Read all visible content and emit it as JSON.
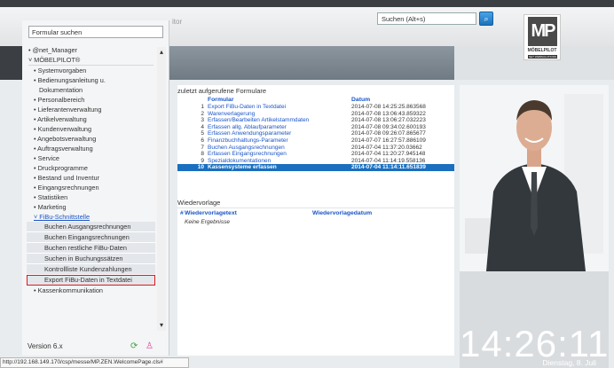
{
  "header": {
    "title_fragment": "itor",
    "search_placeholder": "Suchen (Alt+s)",
    "search_button_icon": "search-icon",
    "logo": {
      "mark": "MP",
      "name": "MÖBELPILOT",
      "tagline": "NET WEBSOLUTIONS"
    }
  },
  "sidebar": {
    "search_value": "Formular suchen",
    "collapse_arrow": "▴",
    "items": [
      {
        "label": "• @net_Manager",
        "level": 0
      },
      {
        "label": "˅ MÖBELPILOT®",
        "level": 0
      },
      {
        "label": "• Systemvorgaben",
        "level": 1
      },
      {
        "label": "• Bedienungsanleitung u.",
        "level": 1
      },
      {
        "label": "Dokumentation",
        "level": 1,
        "cont": true
      },
      {
        "label": "• Personalbereich",
        "level": 1
      },
      {
        "label": "• Lieferantenverwaltung",
        "level": 1
      },
      {
        "label": "• Artikelverwaltung",
        "level": 1
      },
      {
        "label": "• Kundenverwaltung",
        "level": 1
      },
      {
        "label": "• Angebotsverwaltung",
        "level": 1
      },
      {
        "label": "• Auftragsverwaltung",
        "level": 1
      },
      {
        "label": "• Service",
        "level": 1
      },
      {
        "label": "• Druckprogramme",
        "level": 1
      },
      {
        "label": "• Bestand und Inventur",
        "level": 1
      },
      {
        "label": "• Eingangsrechnungen",
        "level": 1
      },
      {
        "label": "• Statistiken",
        "level": 1
      },
      {
        "label": "• Marketing",
        "level": 1
      },
      {
        "label": "˅ FiBu-Schnittstelle",
        "level": 1,
        "active": true
      },
      {
        "label": "Buchen Ausgangsrechnungen",
        "level": 2
      },
      {
        "label": "Buchen Eingangsrechnungen",
        "level": 2
      },
      {
        "label": "Buchen restliche FiBu-Daten",
        "level": 2
      },
      {
        "label": "Suchen in Buchungssätzen",
        "level": 2
      },
      {
        "label": "Kontrollliste Kundenzahlungen",
        "level": 2
      },
      {
        "label": "Export FiBu-Daten in Textdatei",
        "level": 2,
        "highlight": true
      },
      {
        "label": "• Kassenkommunikation",
        "level": 1
      }
    ],
    "scroll_up": "▴",
    "scroll_down": "▾",
    "version": "Version 6.x"
  },
  "status_url": "http://192.168.149.170/csp/messe/MP.ZEN.WelcomePage.cls#",
  "recent": {
    "title": "zuletzt aufgerufene Formulare",
    "col_form": "Formular",
    "col_date": "Datum",
    "rows": [
      {
        "num": "1",
        "form": "Export FiBu-Daten in Textdatei",
        "date": "2014-07-08 14:25:25.863568"
      },
      {
        "num": "2",
        "form": "Warenverlagerung",
        "date": "2014-07-08 13:06:43.859322"
      },
      {
        "num": "3",
        "form": "Erfassen/Bearbeiten Artikelstammdaten",
        "date": "2014-07-08 13:06:27.032223"
      },
      {
        "num": "4",
        "form": "Erfassen allg. Ablaufparameter",
        "date": "2014-07-08 09:34:02.600193"
      },
      {
        "num": "5",
        "form": "Erfassen Anwendungsparameter",
        "date": "2014-07-08 09:26:07.865677"
      },
      {
        "num": "6",
        "form": "Finanzbuchhaltungs-Parameter",
        "date": "2014-07-07 16:27:57.886109"
      },
      {
        "num": "7",
        "form": "Buchen Ausgangsrechnungen",
        "date": "2014-07-04 11:37:20.03662"
      },
      {
        "num": "8",
        "form": "Erfassen Eingangsrechnungen",
        "date": "2014-07-04 11:20:27.945148"
      },
      {
        "num": "9",
        "form": "Spezialdokumentationen",
        "date": "2014-07-04 11:14:19.558136"
      },
      {
        "num": "10",
        "form": "Kassensysteme erfassen",
        "date": "2014-07-04 11:14:11.651839",
        "selected": true
      }
    ]
  },
  "resubmission": {
    "title": "Wiedervorlage",
    "col_num": "#",
    "col_text": "Wiedervorlagetext",
    "col_date": "Wiedervorlagedatum",
    "empty": "Keine Ergebnisse"
  },
  "clock": {
    "time": "14:26:11",
    "date": "Dienstag, 8. Juli"
  },
  "colors": {
    "accent": "#1a6fbf",
    "link": "#1a55c9",
    "highlight_border": "#e0191d"
  }
}
